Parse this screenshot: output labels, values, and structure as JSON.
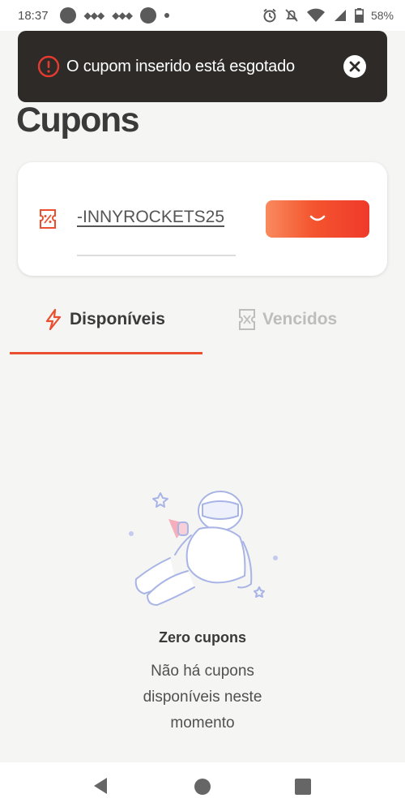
{
  "status_bar": {
    "time": "18:37",
    "battery": "58%",
    "icons": [
      "chat-bubble-icon",
      "game-controller-icon",
      "game-controller-icon",
      "circle-app-icon",
      "dot-icon",
      "alarm-icon",
      "muted-bell-icon",
      "wifi-icon",
      "signal-icon",
      "battery-icon"
    ]
  },
  "toast": {
    "message": "O cupom inserido está esgotado",
    "icon": "alert-circle-icon",
    "close_icon": "close-icon",
    "accent_color": "#e53b2f",
    "background": "#2e2a28"
  },
  "page": {
    "title": "Cupons"
  },
  "coupon_form": {
    "value": "-INNYROCKETS25",
    "icon": "ticket-percent-icon",
    "apply_button_state": "loading",
    "button_gradient": [
      "#f98a5e",
      "#ef3a2a"
    ]
  },
  "tabs": [
    {
      "label": "Disponíveis",
      "icon": "lightning-icon",
      "active": true
    },
    {
      "label": "Vencidos",
      "icon": "expired-ticket-icon",
      "active": false
    }
  ],
  "empty_state": {
    "illustration": "astronaut-illustration",
    "title": "Zero cupons",
    "description": "Não há cupons disponíveis neste momento"
  },
  "nav_bar": {
    "icons": [
      "back-icon",
      "home-icon",
      "recents-icon"
    ]
  },
  "colors": {
    "accent": "#ea4f2f",
    "background": "#f5f5f4",
    "inactive_tab": "#bdbdbd"
  }
}
